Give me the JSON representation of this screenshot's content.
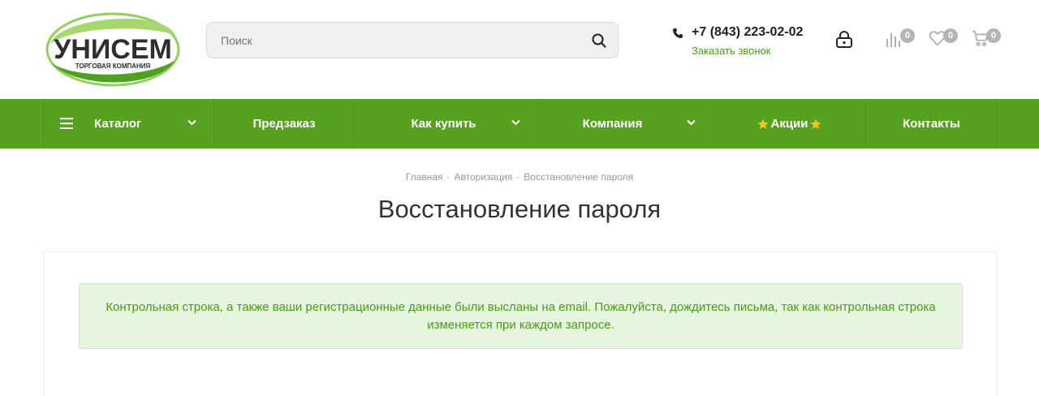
{
  "logo": {
    "name": "УНИСЕМ",
    "tagline": "ТОРГОВАЯ КОМПАНИЯ"
  },
  "search": {
    "placeholder": "Поиск",
    "value": ""
  },
  "contact": {
    "phone": "+7 (843) 223-02-02",
    "callback_label": "Заказать звонок"
  },
  "header_icons": {
    "account": "lock-icon",
    "compare": {
      "icon": "compare-icon",
      "count": "0"
    },
    "favorites": {
      "icon": "heart-icon",
      "count": "0"
    },
    "cart": {
      "icon": "cart-icon",
      "count": "0"
    }
  },
  "nav": {
    "items": [
      {
        "label": "Каталог",
        "has_dropdown": true,
        "icon": "menu-icon"
      },
      {
        "label": "Предзаказ",
        "has_dropdown": false
      },
      {
        "label": "Как купить",
        "has_dropdown": true
      },
      {
        "label": "Компания",
        "has_dropdown": true
      },
      {
        "label": "Акции",
        "has_dropdown": false,
        "icon": "star-icon"
      },
      {
        "label": "Контакты",
        "has_dropdown": false
      }
    ]
  },
  "breadcrumb": {
    "items": [
      "Главная",
      "Авторизация",
      "Восстановление пароля"
    ],
    "separator": "-"
  },
  "page_title": "Восстановление пароля",
  "alert": {
    "message": "Контрольная строка, а также ваши регистрационные данные были высланы на email. Пожалуйста, дождитесь письма, так как контрольная строка изменяется при каждом запросе."
  },
  "colors": {
    "brand_green": "#56a11f",
    "link_green": "#4a9a1a",
    "alert_bg": "#e6f6de",
    "badge_gray": "#b4b4b4",
    "star_yellow": "#f5c21b"
  }
}
